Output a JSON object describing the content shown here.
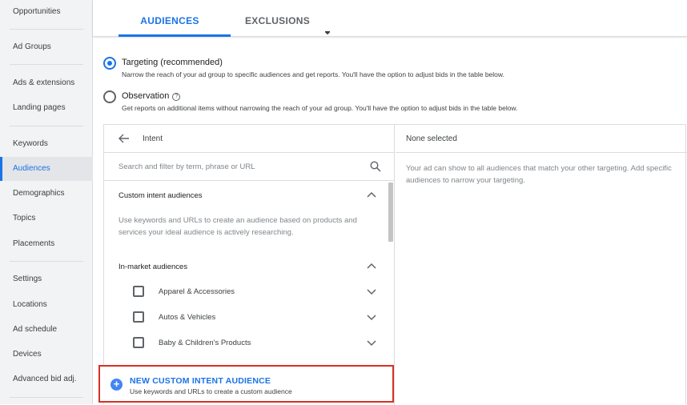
{
  "sidebar": {
    "items": [
      {
        "label": "Opportunities"
      },
      {
        "label": "Ad Groups"
      },
      {
        "label": "Ads & extensions"
      },
      {
        "label": "Landing pages"
      },
      {
        "label": "Keywords"
      },
      {
        "label": "Audiences"
      },
      {
        "label": "Demographics"
      },
      {
        "label": "Topics"
      },
      {
        "label": "Placements"
      },
      {
        "label": "Settings"
      },
      {
        "label": "Locations"
      },
      {
        "label": "Ad schedule"
      },
      {
        "label": "Devices"
      },
      {
        "label": "Advanced bid adj."
      }
    ],
    "active_label": "Audiences"
  },
  "tabs": {
    "audiences": "AUDIENCES",
    "exclusions": "EXCLUSIONS"
  },
  "targeting": {
    "title": "Targeting (recommended)",
    "desc": "Narrow the reach of your ad group to specific audiences and get reports. You'll have the option to adjust bids in the table below."
  },
  "observation": {
    "title": "Observation",
    "desc": "Get reports on additional items without narrowing the reach of your ad group. You'll have the option to adjust bids in the table below."
  },
  "browse": {
    "back_label": "Intent",
    "search_placeholder": "Search and filter by term, phrase or URL",
    "custom_intent": {
      "title": "Custom intent audiences",
      "desc": "Use keywords and URLs to create an audience based on products and services your ideal audience is actively researching."
    },
    "in_market": {
      "title": "In-market audiences",
      "categories": [
        "Apparel & Accessories",
        "Autos & Vehicles",
        "Baby & Children's Products"
      ]
    }
  },
  "selected": {
    "header": "None selected",
    "desc": "Your ad can show to all audiences that match your other targeting. Add specific audiences to narrow your targeting."
  },
  "new_custom_intent": {
    "title": "NEW CUSTOM INTENT AUDIENCE",
    "subtitle": "Use keywords and URLs to create a custom audience"
  },
  "colors": {
    "accent": "#1a73e8",
    "highlight_border": "#d93025"
  }
}
